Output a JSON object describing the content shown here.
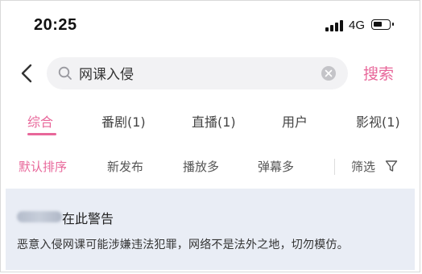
{
  "status_bar": {
    "time": "20:25",
    "network": "4G"
  },
  "search": {
    "query": "网课入侵",
    "button_label": "搜索"
  },
  "tabs": [
    {
      "label": "综合",
      "active": true
    },
    {
      "label": "番剧(1)",
      "active": false
    },
    {
      "label": "直播(1)",
      "active": false
    },
    {
      "label": "用户",
      "active": false
    },
    {
      "label": "影视(1)",
      "active": false
    }
  ],
  "sort": {
    "options": [
      {
        "label": "默认排序",
        "active": true
      },
      {
        "label": "新发布",
        "active": false
      },
      {
        "label": "播放多",
        "active": false
      },
      {
        "label": "弹幕多",
        "active": false
      }
    ],
    "filter_label": "筛选"
  },
  "warning": {
    "title": "在此警告",
    "message": "恶意入侵网课可能涉嫌违法犯罪，网络不是法外之地，切勿模仿。"
  },
  "colors": {
    "accent": "#e8679a",
    "card_bg": "#e9edf5",
    "search_bg": "#f2f2f4"
  },
  "icons": [
    "back-arrow-icon",
    "search-icon",
    "clear-icon",
    "filter-funnel-icon",
    "signal-icon",
    "battery-icon"
  ]
}
